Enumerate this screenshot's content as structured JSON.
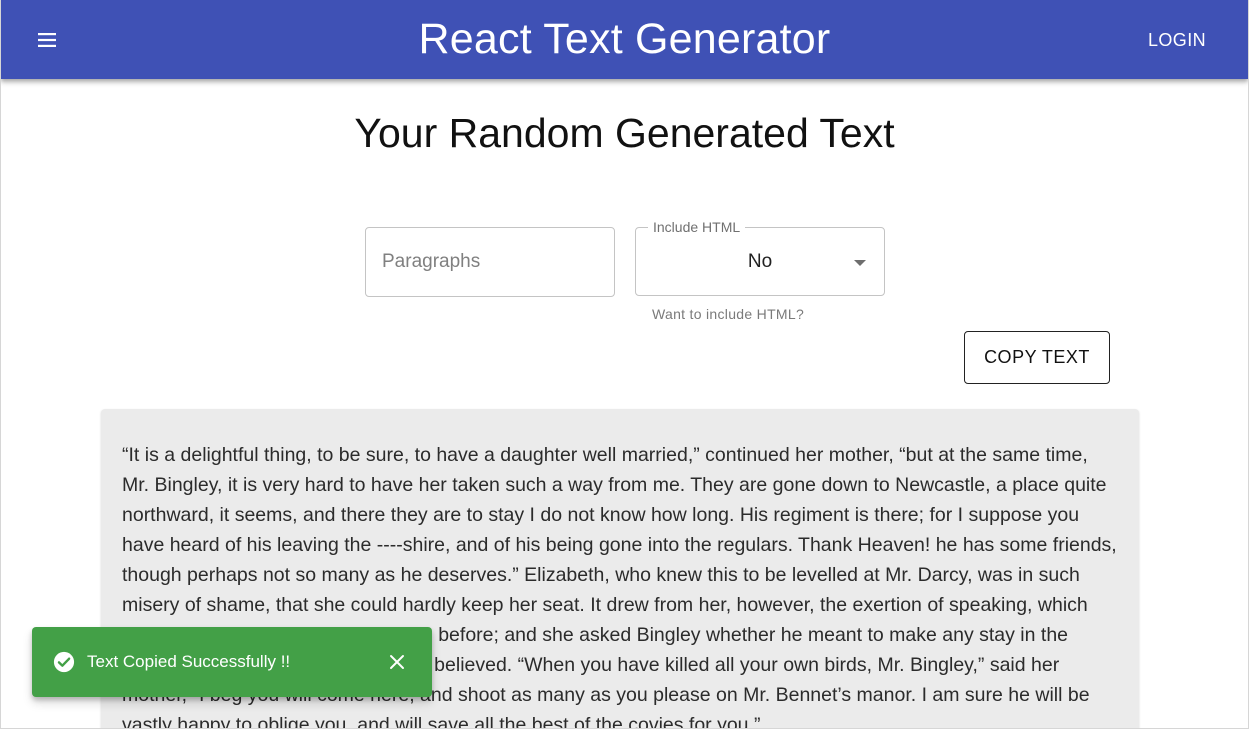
{
  "appbar": {
    "title": "React Text Generator",
    "login_label": "LOGIN",
    "menu_icon": "menu-icon",
    "color": "#3f51b5"
  },
  "main": {
    "heading": "Your Random Generated Text",
    "paragraphs_field": {
      "placeholder": "Paragraphs",
      "value": ""
    },
    "include_html": {
      "label": "Include HTML",
      "selected": "No",
      "helper": "Want to include HTML?",
      "icon": "dropdown-arrow-icon"
    },
    "copy_button_label": "COPY TEXT",
    "generated_text": "“It is a delightful thing, to be sure, to have a daughter well married,” continued her mother, “but at the same time, Mr. Bingley, it is very hard to have her taken such a way from me. They are gone down to Newcastle, a place quite northward, it seems, and there they are to stay I do not know how long. His regiment is there; for I suppose you have heard of his leaving the ----shire, and of his being gone into the regulars. Thank Heaven! he has some friends, though perhaps not so many as he deserves.” Elizabeth, who knew this to be levelled at Mr. Darcy, was in such misery of shame, that she could hardly keep her seat. It drew from her, however, the exertion of speaking, which nothing else had so effectually done before; and she asked Bingley whether he meant to make any stay in the country at present. A few weeks, he believed. “When you have killed all your own birds, Mr. Bingley,” said her mother, “I beg you will come here, and shoot as many as you please on Mr. Bennet’s manor. I am sure he will be vastly happy to oblige you, and will save all the best of the covies for you.”"
  },
  "snackbar": {
    "message": "Text Copied Successfully !!",
    "status_icon": "check-circle-icon",
    "close_icon": "close-icon",
    "color": "#43a047"
  }
}
